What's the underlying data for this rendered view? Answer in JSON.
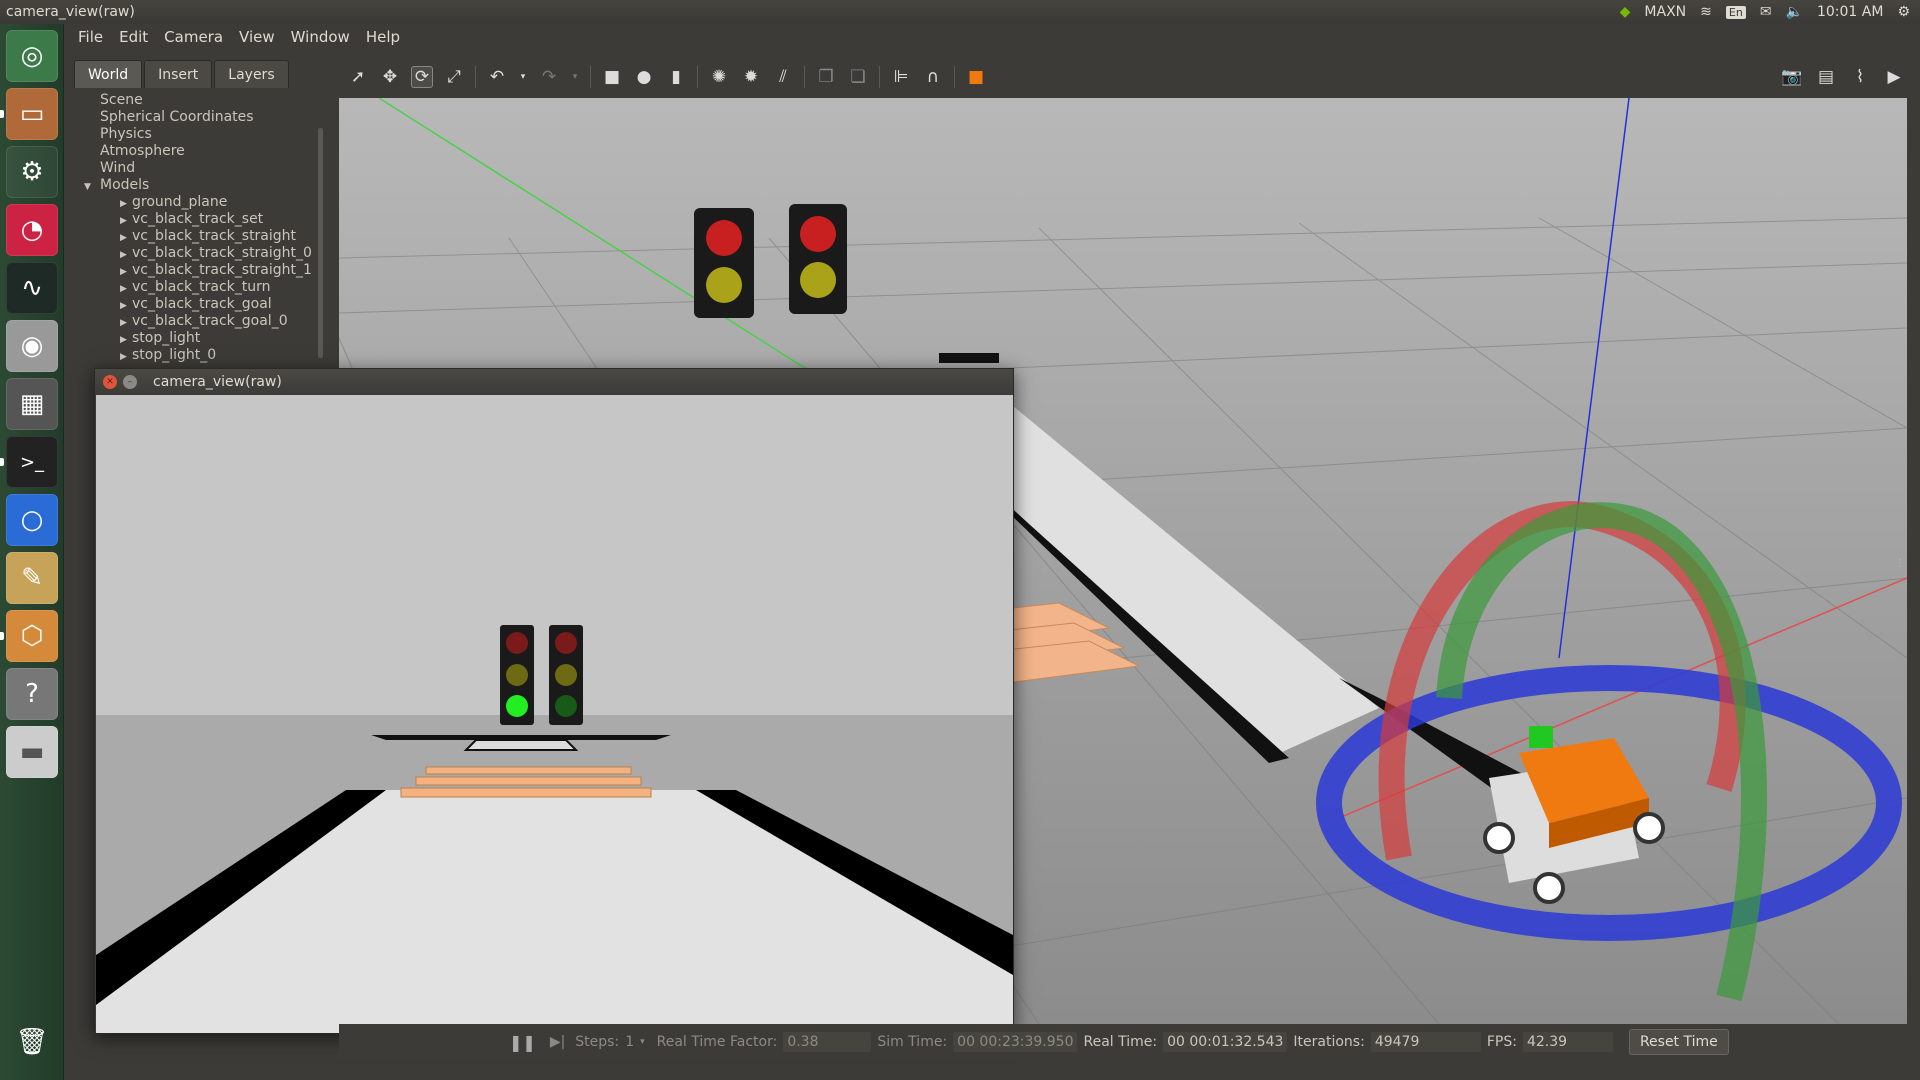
{
  "window_title": "camera_view(raw)",
  "system_tray": {
    "gpu_mode": "MAXN",
    "keyboard": "En",
    "time": "10:01 AM"
  },
  "menu": [
    "File",
    "Edit",
    "Camera",
    "View",
    "Window",
    "Help"
  ],
  "left_panel": {
    "tabs": [
      "World",
      "Insert",
      "Layers"
    ],
    "active_tab": "World",
    "tree": {
      "top_items": [
        "Scene",
        "Spherical Coordinates",
        "Physics",
        "Atmosphere",
        "Wind"
      ],
      "models_label": "Models",
      "models": [
        "ground_plane",
        "vc_black_track_set",
        "vc_black_track_straight",
        "vc_black_track_straight_0",
        "vc_black_track_straight_1",
        "vc_black_track_turn",
        "vc_black_track_goal",
        "vc_black_track_goal_0",
        "stop_light",
        "stop_light_0"
      ]
    }
  },
  "camera_window": {
    "title": "camera_view(raw)"
  },
  "status": {
    "steps_label": "Steps:",
    "steps_value": "1",
    "rtf_label": "Real Time Factor:",
    "rtf_value": "0.38",
    "sim_time_label": "Sim Time:",
    "sim_time_value": "00 00:23:39.950",
    "real_time_label": "Real Time:",
    "real_time_value": "00 00:01:32.543",
    "iterations_label": "Iterations:",
    "iterations_value": "49479",
    "fps_label": "FPS:",
    "fps_value": "42.39",
    "reset_label": "Reset Time"
  },
  "colors": {
    "launcher": "#2c4a33",
    "window_bg": "#3c3b37",
    "ring_x": "#d63a3a",
    "ring_y": "#3a9a3a",
    "ring_z": "#2a3ad6",
    "robot_body": "#f07a10",
    "traffic_light_green_on": "#22ee22"
  }
}
